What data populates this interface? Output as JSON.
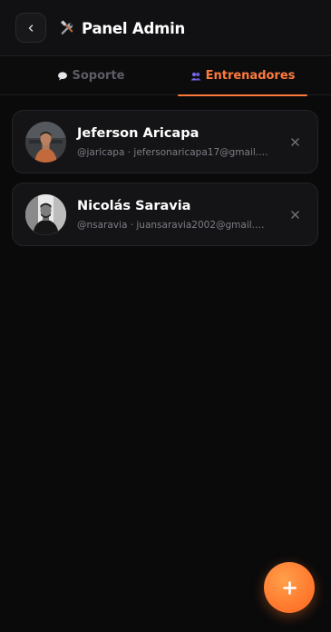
{
  "header": {
    "title": "Panel Admin",
    "title_icon": "tools-icon",
    "back_icon": "chevron-left-icon"
  },
  "tabs": [
    {
      "label": "Soporte",
      "icon": "speech-bubble-icon",
      "active": false
    },
    {
      "label": "Entrenadores",
      "icon": "people-icon",
      "active": true
    }
  ],
  "trainers": [
    {
      "name": "Jeferson Aricapa",
      "meta": "@jaricapa · jefersonaricapa17@gmail.com"
    },
    {
      "name": "Nicolás Saravia",
      "meta": "@nsaravia · juansaravia2002@gmail.com"
    }
  ],
  "fab": {
    "icon": "plus-icon"
  },
  "colors": {
    "accent": "#ff7a3d",
    "background": "#0a0a0b",
    "card": "#141416",
    "muted_text": "#7d7d86"
  }
}
